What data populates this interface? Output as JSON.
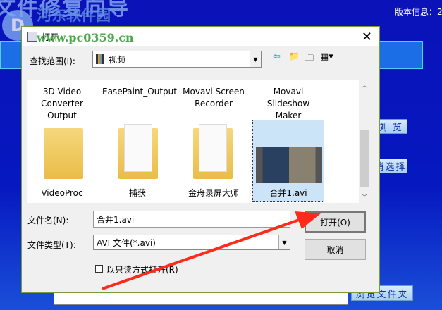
{
  "app": {
    "title": "文件修复向导",
    "version_label": "版本信息：2",
    "watermark_name": "河东软件园",
    "watermark_url": "www.pc0359.cn"
  },
  "side_buttons": [
    "浏 览",
    "消选择",
    "浏览文件夹"
  ],
  "dialog": {
    "title": "打开",
    "look_in_label": "查找范围(I):",
    "look_in_value": "视频",
    "items": [
      {
        "label": "3D Video Converter Output"
      },
      {
        "label": "EasePaint_Output"
      },
      {
        "label": "Movavi Screen Recorder"
      },
      {
        "label": "Movavi Slideshow Maker"
      },
      {
        "label": "VideoProc"
      },
      {
        "label": "捕获"
      },
      {
        "label": "金舟录屏大师"
      },
      {
        "label": "合并1.avi",
        "selected": true
      }
    ],
    "filename_label": "文件名(N):",
    "filename_value": "合并1.avi",
    "filetype_label": "文件类型(T):",
    "filetype_value": "AVI 文件(*.avi)",
    "readonly_label": "以只读方式打开(R)",
    "open_button": "打开(O)",
    "cancel_button": "取消"
  },
  "colors": {
    "accent": "#cce4f7",
    "arrow": "#ff2a1a"
  }
}
